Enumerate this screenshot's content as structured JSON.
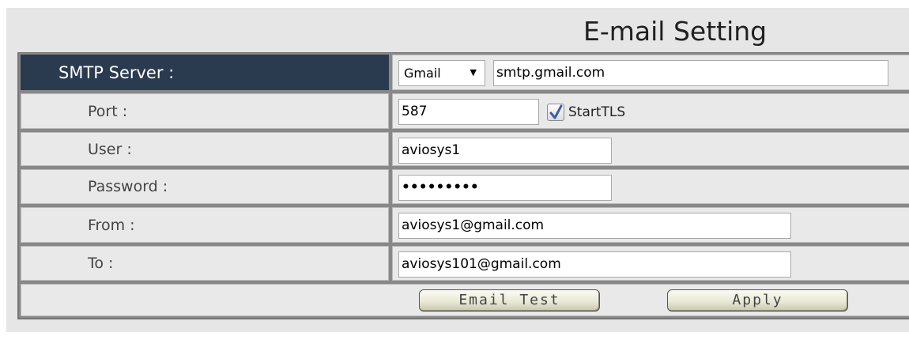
{
  "page": {
    "title": "E-mail Setting"
  },
  "smtp": {
    "label": "SMTP Server :",
    "provider": "Gmail",
    "server": "smtp.gmail.com"
  },
  "port": {
    "label": "Port :",
    "value": "587",
    "starttls_label": "StartTLS",
    "starttls_checked": true
  },
  "user": {
    "label": "User :",
    "value": "aviosys1"
  },
  "password": {
    "label": "Password :",
    "masked": "•••••••••"
  },
  "from": {
    "label": "From :",
    "value": "aviosys1@gmail.com"
  },
  "to": {
    "label": "To :",
    "value": "aviosys101@gmail.com"
  },
  "buttons": {
    "email_test": "Email Test",
    "apply": "Apply"
  },
  "colors": {
    "header_bg": "#2b3b4f",
    "panel_bg": "#e6e6e6",
    "check_color": "#3a5fa8"
  }
}
